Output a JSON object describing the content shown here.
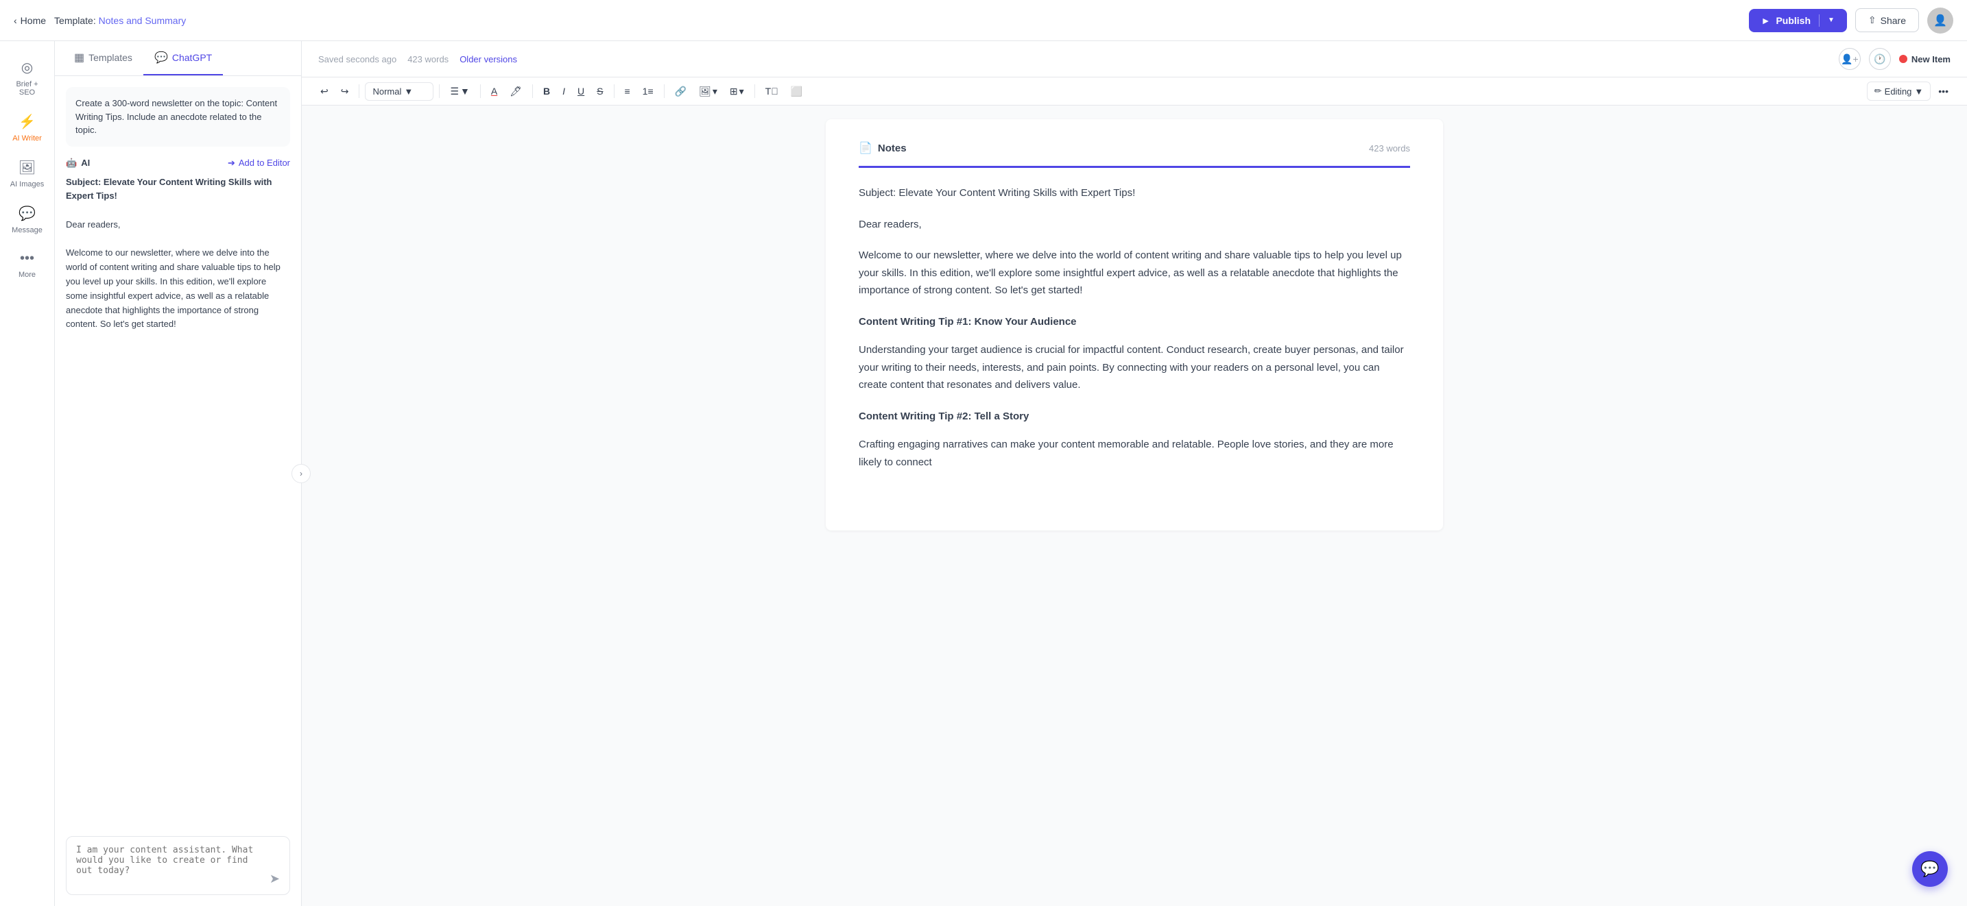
{
  "topbar": {
    "back_label": "Home",
    "template_prefix": "Template:",
    "template_name": "Notes and Summary",
    "publish_label": "Publish",
    "share_label": "Share"
  },
  "sidebar": {
    "items": [
      {
        "id": "brief-seo",
        "icon": "◎",
        "label": "Brief + SEO"
      },
      {
        "id": "ai-writer",
        "icon": "⚡",
        "label": "AI Writer"
      },
      {
        "id": "ai-images",
        "icon": "🖼",
        "label": "AI Images"
      },
      {
        "id": "message",
        "icon": "💬",
        "label": "Message"
      },
      {
        "id": "more",
        "icon": "•••",
        "label": "More"
      }
    ]
  },
  "panel": {
    "tabs": [
      {
        "id": "templates",
        "icon": "▦",
        "label": "Templates"
      },
      {
        "id": "chatgpt",
        "icon": "💬",
        "label": "ChatGPT"
      }
    ],
    "active_tab": "chatgpt",
    "prompt": "Create a 300-word newsletter on the topic: Content Writing Tips. Include an anecdote related to the topic.",
    "ai_label": "AI",
    "add_to_editor_label": "Add to Editor",
    "ai_response": "Subject: Elevate Your Content Writing Skills with Expert Tips!\n\nDear readers,\n\nWelcome to our newsletter, where we delve into the world of content writing and share valuable tips to help you level up your skills. In this edition, we'll explore some insightful expert advice, as well as a relatable anecdote that highlights the importance of strong content. So let's get started!",
    "chat_placeholder": "I am your content assistant. What would you like to create or find out today?"
  },
  "editor": {
    "saved_text": "Saved seconds ago",
    "word_count": "423 words",
    "older_versions": "Older versions",
    "new_item_label": "New Item",
    "doc_title": "Notes",
    "doc_word_count": "423 words",
    "toolbar": {
      "format_label": "Normal",
      "editing_label": "Editing"
    },
    "content": {
      "subject_line": "Subject: Elevate Your Content Writing Skills with Expert Tips!",
      "greeting": "Dear readers,",
      "intro": "Welcome to our newsletter, where we delve into the world of content writing and share valuable tips to help you level up your skills. In this edition, we'll explore some insightful expert advice, as well as a relatable anecdote that highlights the importance of strong content. So let's get started!",
      "tip1_title": "Content Writing Tip #1: Know Your Audience",
      "tip1_body": "Understanding your target audience is crucial for impactful content. Conduct research, create buyer personas, and tailor your writing to their needs, interests, and pain points. By connecting with your readers on a personal level, you can create content that resonates and delivers value.",
      "tip2_title": "Content Writing Tip #2: Tell a Story",
      "tip2_body": "Crafting engaging narratives can make your content memorable and relatable. People love stories, and they are more likely to connect"
    }
  }
}
